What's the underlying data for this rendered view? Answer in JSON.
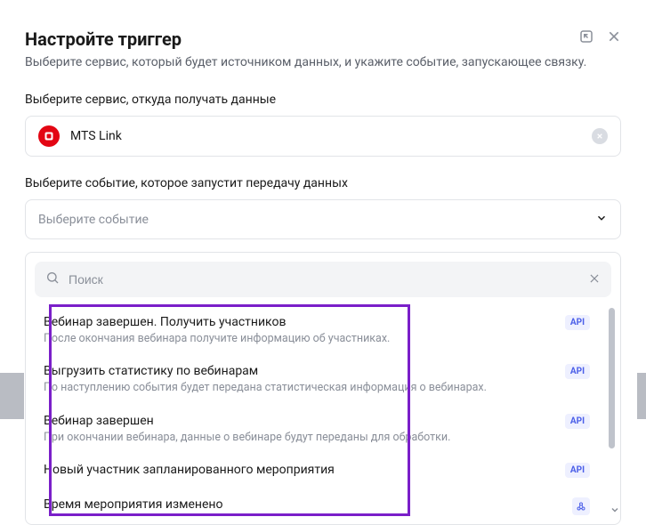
{
  "header": {
    "title": "Настройте триггер",
    "subtitle": "Выберите сервис, который будет источником данных, и укажите событие, запускающее связку."
  },
  "service_section": {
    "label": "Выберите сервис, откуда получать данные",
    "selected": "MTS Link"
  },
  "event_section": {
    "label": "Выберите событие, которое запустит передачу данных",
    "placeholder": "Выберите событие"
  },
  "search": {
    "placeholder": "Поиск"
  },
  "badges": {
    "api": "API"
  },
  "options": [
    {
      "title": "Вебинар завершен. Получить участников",
      "desc": "После окончания вебинара получите информацию об участниках.",
      "badge": "api"
    },
    {
      "title": "Выгрузить статистику по вебинарам",
      "desc": "По наступлению события будет передана статистическая информация о вебинарах.",
      "badge": "api"
    },
    {
      "title": "Вебинар завершен",
      "desc": "При окончании вебинара, данные о вебинаре будут переданы для обработки.",
      "badge": "api"
    },
    {
      "title": "Новый участник запланированного мероприятия",
      "desc": "",
      "badge": "api"
    },
    {
      "title": "Время мероприятия изменено",
      "desc": "",
      "badge": "webhook"
    }
  ]
}
